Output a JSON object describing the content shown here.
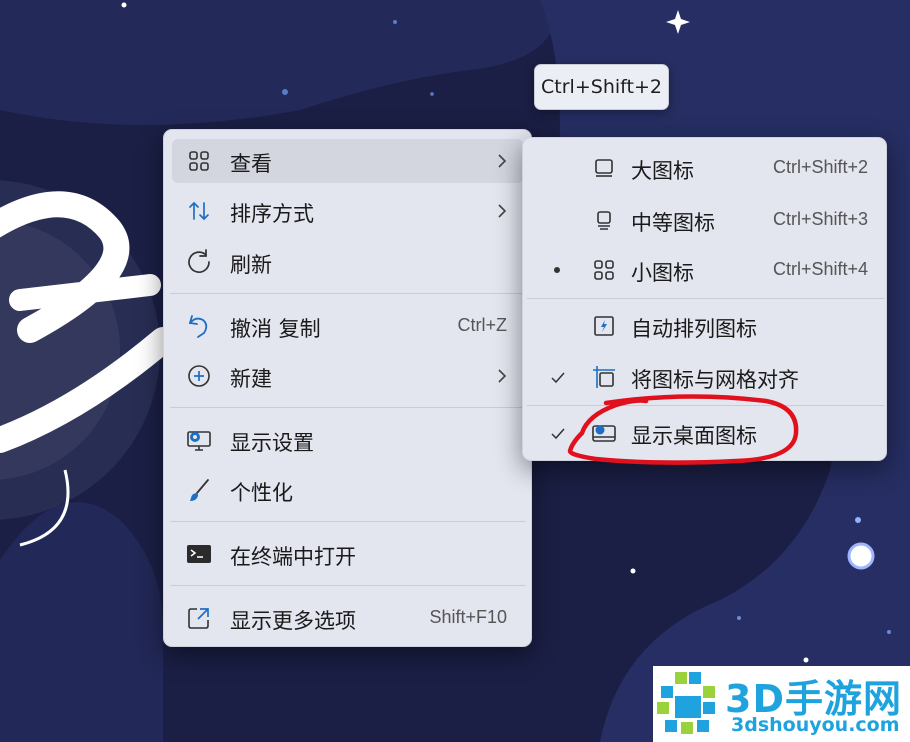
{
  "tooltip": {
    "text": "Ctrl+Shift+2"
  },
  "context_menu": {
    "items": [
      {
        "label": "查看",
        "icon": "grid-view-icon",
        "has_submenu": true
      },
      {
        "label": "排序方式",
        "icon": "sort-arrows-icon",
        "has_submenu": true
      },
      {
        "label": "刷新",
        "icon": "refresh-icon"
      },
      {
        "label": "撤消 复制",
        "icon": "undo-icon",
        "shortcut": "Ctrl+Z"
      },
      {
        "label": "新建",
        "icon": "new-plus-circle-icon",
        "has_submenu": true
      },
      {
        "label": "显示设置",
        "icon": "display-settings-icon"
      },
      {
        "label": "个性化",
        "icon": "paintbrush-icon"
      },
      {
        "label": "在终端中打开",
        "icon": "terminal-icon"
      },
      {
        "label": "显示更多选项",
        "icon": "open-external-icon",
        "shortcut": "Shift+F10"
      }
    ]
  },
  "view_submenu": {
    "items": [
      {
        "label": "大图标",
        "icon": "large-icons-icon",
        "shortcut": "Ctrl+Shift+2"
      },
      {
        "label": "中等图标",
        "icon": "medium-icons-icon",
        "shortcut": "Ctrl+Shift+3"
      },
      {
        "label": "小图标",
        "icon": "small-icons-grid-icon",
        "shortcut": "Ctrl+Shift+4",
        "selected": true
      },
      {
        "label": "自动排列图标",
        "icon": "auto-arrange-icon"
      },
      {
        "label": "将图标与网格对齐",
        "icon": "align-to-grid-icon",
        "checked": true
      },
      {
        "label": "显示桌面图标",
        "icon": "show-desktop-icons-icon",
        "checked": true
      }
    ]
  },
  "annotation": {
    "color": "#e0111d"
  },
  "watermark": {
    "name": "3D手游网",
    "url": "3dshouyou.com",
    "color": "#1fa3df"
  },
  "colors": {
    "menu_bg": "#e3e5ef",
    "accent": "#1e7fd1",
    "wallpaper": "#1b1f45"
  }
}
